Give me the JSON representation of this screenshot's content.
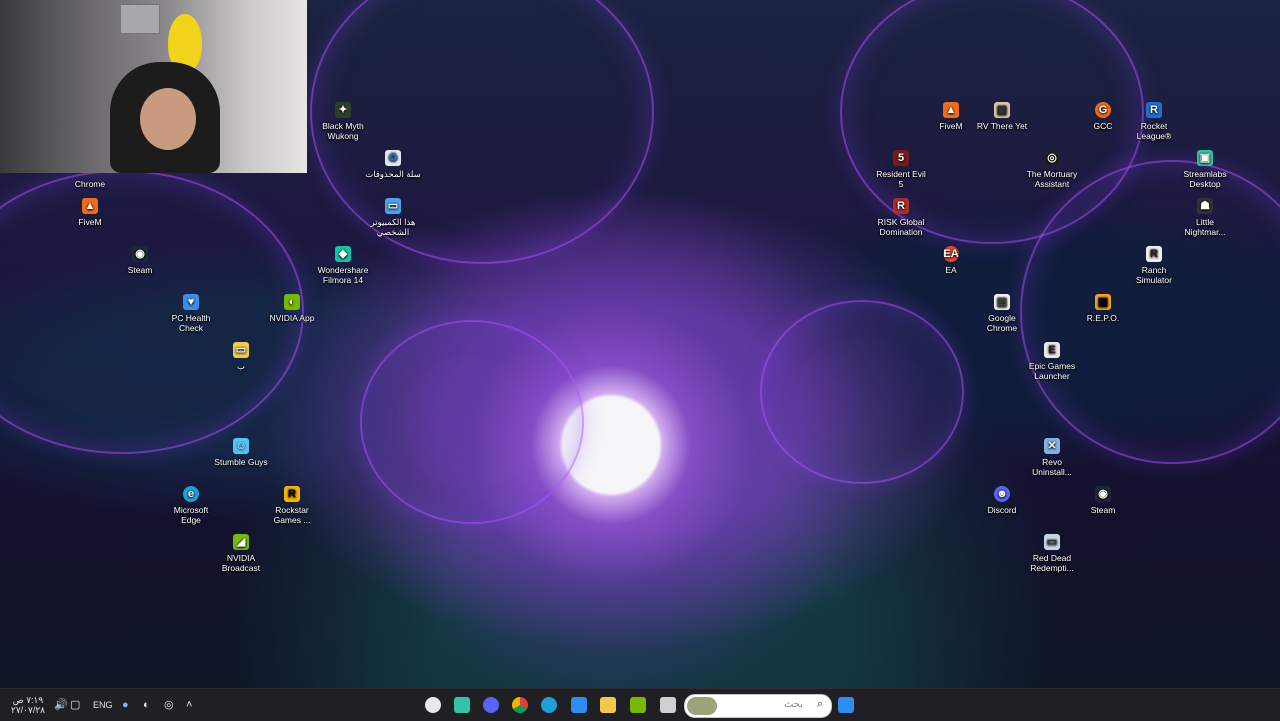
{
  "desktop_icons": {
    "fivem_left": {
      "label": "FiveM",
      "icon": "fivem-icon"
    },
    "chrome_left": {
      "label": "Chrome",
      "icon": "chrome-icon"
    },
    "steam_left": {
      "label": "Steam",
      "icon": "steam-icon"
    },
    "pc_health": {
      "label": "PC Health Check",
      "icon": "pc-health-check-icon"
    },
    "nvidia_app": {
      "label": "NVIDIA App",
      "icon": "nvidia-icon"
    },
    "folder_ba": {
      "label": "ب",
      "icon": "folder-icon"
    },
    "stumble": {
      "label": "Stumble Guys",
      "icon": "stumble-guys-icon"
    },
    "edge": {
      "label": "Microsoft Edge",
      "icon": "edge-icon"
    },
    "rockstar": {
      "label": "Rockstar Games ...",
      "icon": "rockstar-icon"
    },
    "nvidia_broadcast": {
      "label": "NVIDIA Broadcast",
      "icon": "nvidia-broadcast-icon"
    },
    "black_myth": {
      "label": "Black Myth Wukong",
      "icon": "black-myth-icon"
    },
    "recycle": {
      "label": "سلة المحذوفات",
      "icon": "recycle-bin-icon"
    },
    "this_pc": {
      "label": "هذا الكمبيوتر الشخصي",
      "icon": "this-pc-icon"
    },
    "filmora": {
      "label": "Wondershare Filmora 14",
      "icon": "filmora-icon"
    },
    "fivem_right": {
      "label": "FiveM",
      "icon": "fivem-icon"
    },
    "rv": {
      "label": "RV There Yet",
      "icon": "rv-there-yet-icon"
    },
    "gcc": {
      "label": "GCC",
      "icon": "gcc-icon"
    },
    "rocket": {
      "label": "Rocket League®",
      "icon": "rocket-league-icon"
    },
    "re5": {
      "label": "Resident Evil 5",
      "icon": "resident-evil-icon"
    },
    "mortuary": {
      "label": "The Mortuary Assistant",
      "icon": "mortuary-assistant-icon"
    },
    "streamlabs": {
      "label": "Streamlabs Desktop",
      "icon": "streamlabs-icon"
    },
    "risk": {
      "label": "RISK Global Domination",
      "icon": "risk-icon"
    },
    "little": {
      "label": "Little Nightmar...",
      "icon": "little-nightmares-icon"
    },
    "ea": {
      "label": "EA",
      "icon": "ea-icon"
    },
    "ranch": {
      "label": "Ranch Simulator",
      "icon": "ranch-simulator-icon"
    },
    "chrome_right": {
      "label": "Google Chrome",
      "icon": "chrome-icon"
    },
    "repo": {
      "label": "R.E.P.O.",
      "icon": "repo-icon"
    },
    "epic": {
      "label": "Epic Games Launcher",
      "icon": "epic-games-icon"
    },
    "revo": {
      "label": "Revo Uninstall...",
      "icon": "revo-uninstaller-icon"
    },
    "discord": {
      "label": "Discord",
      "icon": "discord-icon"
    },
    "steam_right": {
      "label": "Steam",
      "icon": "steam-icon"
    },
    "rdr": {
      "label": "Red Dead Redempti...",
      "icon": "red-dead-icon"
    }
  },
  "taskbar": {
    "clock_time": "٧:١٩ ص",
    "clock_date": "٢٧/٠٧/٢٨",
    "language": "ENG",
    "search_placeholder": "بحث",
    "apps": [
      "steelseries-icon",
      "streamlabs-icon",
      "discord-icon",
      "chrome-icon",
      "edge-icon",
      "filmora-icon",
      "file-explorer-icon",
      "nvidia-icon",
      "task-view-icon"
    ],
    "colors": {
      "bar": "#1f1f24",
      "accent": "#2f8cf0"
    }
  }
}
